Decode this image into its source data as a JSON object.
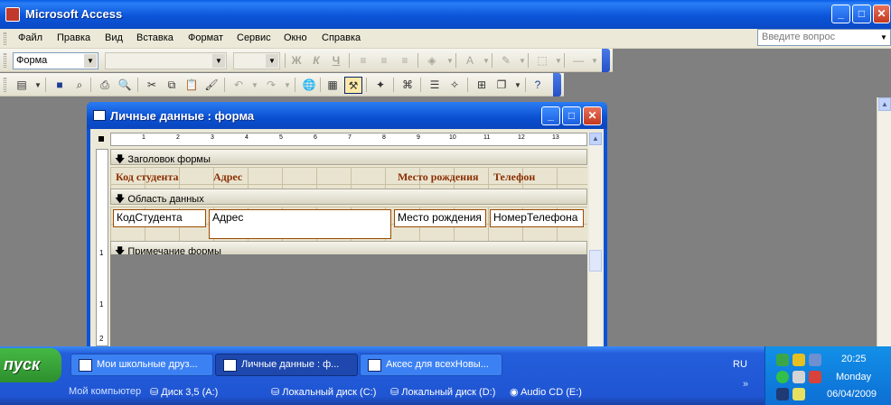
{
  "app": {
    "title": "Microsoft Access"
  },
  "menu": {
    "items": [
      "Файл",
      "Правка",
      "Вид",
      "Вставка",
      "Формат",
      "Сервис",
      "Окно",
      "Справка"
    ],
    "help_placeholder": "Введите вопрос"
  },
  "toolbar": {
    "object_combo": "Форма",
    "bold": "Ж",
    "italic": "К",
    "underline": "Ч"
  },
  "form_window": {
    "title": "Личные данные : форма",
    "ruler_numbers": [
      "1",
      "2",
      "3",
      "4",
      "5",
      "6",
      "7",
      "8",
      "9",
      "10",
      "11",
      "12",
      "13"
    ],
    "vruler_numbers": [
      "1",
      "1",
      "2"
    ],
    "sections": {
      "header": "Заголовок формы",
      "detail": "Область данных",
      "footer": "Примечание формы"
    },
    "header_labels": [
      "Код студента",
      "Адрес",
      "Место рождения",
      "Телефон"
    ],
    "fields": [
      "КодСтудента",
      "Адрес",
      "Место рождения",
      "НомерТелефона"
    ]
  },
  "taskbar": {
    "start_label": "пуск",
    "tasks": [
      {
        "label": "Мои школьные друз..."
      },
      {
        "label": "Личные данные : ф..."
      },
      {
        "label": "Аксес для всехНовы..."
      }
    ],
    "quick_links": [
      "Мой компьютер",
      "Диск 3,5 (A:)",
      "Локальный диск (C:)",
      "Локальный диск (D:)",
      "Audio CD (E:)"
    ],
    "language": "RU",
    "clock": {
      "time": "20:25",
      "day": "Monday",
      "date": "06/04/2009"
    }
  },
  "colors": {
    "title_blue": "#0b55d9",
    "label_brown": "#8b2f00",
    "workspace_gray": "#808080",
    "start_green": "#2d8f2d"
  }
}
